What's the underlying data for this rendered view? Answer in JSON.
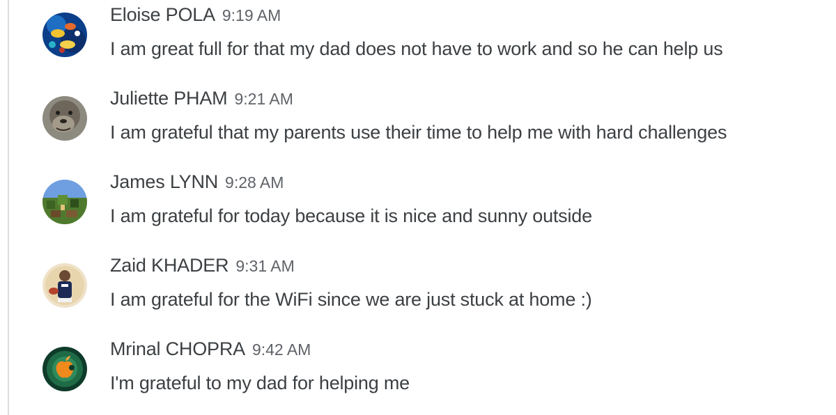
{
  "comments": [
    {
      "author": "Eloise POLA",
      "time": "9:19 AM",
      "text": "I am great full for that my dad does not have to work and so he can help us",
      "avatar": "coral-reef-fish-avatar"
    },
    {
      "author": "Juliette PHAM",
      "time": "9:21 AM",
      "text": "I am grateful that my parents use their time to help me with hard challenges",
      "avatar": "quokka-avatar"
    },
    {
      "author": "James LYNN",
      "time": "9:28 AM",
      "text": "I am grateful for today because it is nice and sunny outside",
      "avatar": "blocky-landscape-avatar"
    },
    {
      "author": "Zaid KHADER",
      "time": "9:31 AM",
      "text": "I am grateful for the WiFi since we are just stuck at home :)",
      "avatar": "football-player-avatar"
    },
    {
      "author": "Mrinal CHOPRA",
      "time": "9:42 AM",
      "text": "I'm grateful to my dad for helping me",
      "avatar": "apple-logo-avatar"
    }
  ]
}
